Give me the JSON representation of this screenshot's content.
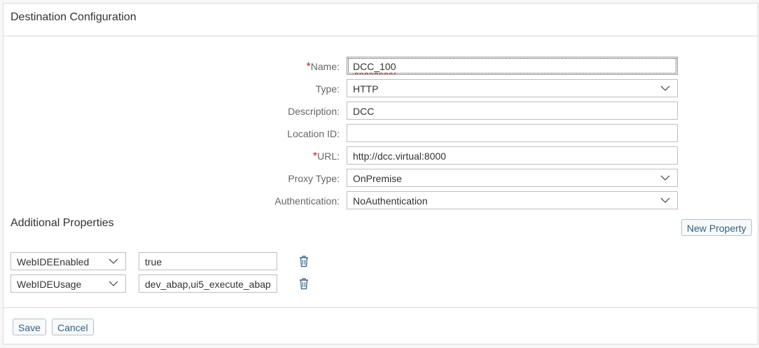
{
  "header": {
    "title": "Destination Configuration"
  },
  "form": {
    "name": {
      "label": "Name:",
      "required_mark": "*",
      "value": "DCC_100"
    },
    "type": {
      "label": "Type:",
      "value": "HTTP"
    },
    "description": {
      "label": "Description:",
      "value": "DCC"
    },
    "location_id": {
      "label": "Location ID:",
      "value": ""
    },
    "url": {
      "label": "URL:",
      "required_mark": "*",
      "value": "http://dcc.virtual:8000"
    },
    "proxy_type": {
      "label": "Proxy Type:",
      "value": "OnPremise"
    },
    "authentication": {
      "label": "Authentication:",
      "value": "NoAuthentication"
    }
  },
  "additional_properties": {
    "title": "Additional Properties",
    "new_property_label": "New Property",
    "rows": [
      {
        "key": "WebIDEEnabled",
        "value": "true"
      },
      {
        "key": "WebIDEUsage",
        "value": "dev_abap,ui5_execute_abap"
      }
    ]
  },
  "footer": {
    "save_label": "Save",
    "cancel_label": "Cancel"
  },
  "colors": {
    "required": "#cc1919",
    "button_text": "#346187",
    "icon": "#346187"
  }
}
